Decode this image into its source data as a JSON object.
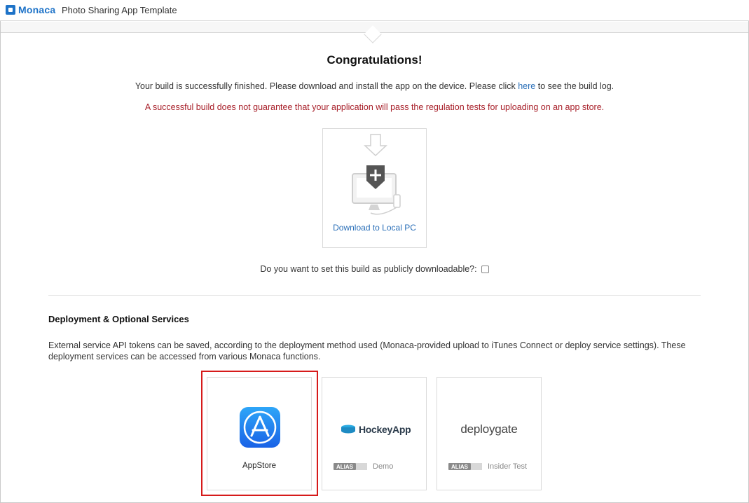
{
  "header": {
    "logo_text": "Monaca",
    "project_title": "Photo Sharing App Template"
  },
  "main": {
    "heading": "Congratulations!",
    "info_before": "Your build is successfully finished. Please download and install the app on the device. Please click ",
    "info_link": "here",
    "info_after": " to see the build log.",
    "warning": "A successful build does not guarantee that your application will pass the regulation tests for uploading on an app store.",
    "download_label": "Download to Local PC",
    "public_question": "Do you want to set this build as publicly downloadable?:",
    "public_checked": false
  },
  "deployment": {
    "title": "Deployment & Optional Services",
    "description": "External service API tokens can be saved, according to the deployment method used (Monaca-provided upload to iTunes Connect or deploy service settings). These deployment services can be accessed from various Monaca functions.",
    "services": [
      {
        "label": "AppStore",
        "icon": "appstore-icon",
        "highlighted": true
      },
      {
        "logo_text": "HockeyApp",
        "icon": "hockeyapp-logo",
        "alias_badge": "ALIAS",
        "alias_name": "Demo"
      },
      {
        "logo_text": "deploygate",
        "icon": "deploygate-logo",
        "alias_badge": "ALIAS",
        "alias_name": "Insider Test"
      }
    ]
  },
  "colors": {
    "brand": "#1e73c8",
    "link": "#2a6fb8",
    "warning": "#a8202a",
    "highlight": "#d61a1a"
  }
}
